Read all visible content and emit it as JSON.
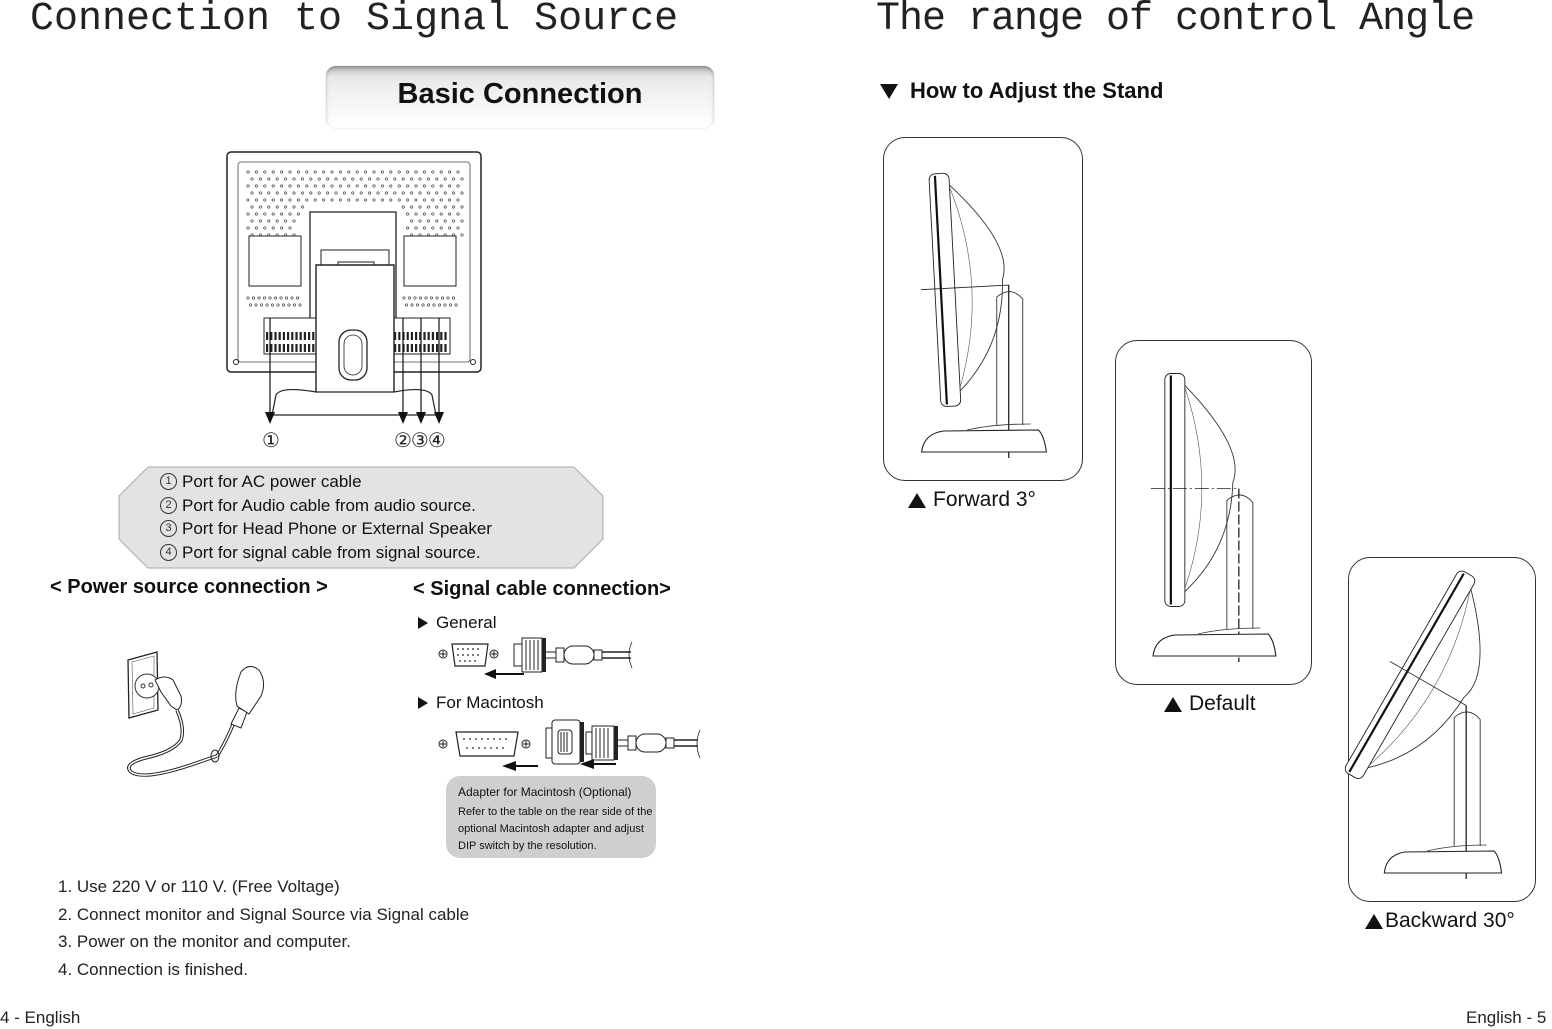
{
  "left_page": {
    "title": "Connection to Signal Source",
    "basic_connection_label": "Basic Connection",
    "port_callouts": [
      "①",
      "②③④"
    ],
    "port_legend": [
      {
        "num": "1",
        "text": "Port for AC power cable"
      },
      {
        "num": "2",
        "text": "Port for Audio cable  from audio source."
      },
      {
        "num": "3",
        "text": "Port for Head Phone or External Speaker"
      },
      {
        "num": "4",
        "text": "Port for signal cable from signal source."
      }
    ],
    "power_heading": "< Power source connection >",
    "signal_heading": "< Signal cable connection>",
    "signal_options": [
      {
        "label": "General",
        "icon": "triangle-right-icon"
      },
      {
        "label": "For Macintosh",
        "icon": "triangle-right-icon"
      }
    ],
    "adapter_note": {
      "title": "Adapter for Macintosh (Optional)",
      "body": "Refer to the table on the rear side of the optional Macintosh adapter and adjust DIP switch by the resolution."
    },
    "steps": [
      "1. Use 220 V or 110 V. (Free Voltage)",
      "2. Connect monitor and Signal Source via Signal cable",
      "3. Power on the monitor and computer.",
      "4. Connection is finished."
    ],
    "footer": "4 - English"
  },
  "right_page": {
    "title": "The range of control  Angle",
    "subheading": "How to Adjust the Stand",
    "positions": [
      {
        "label": "Forward 3°",
        "tilt_degrees": -3
      },
      {
        "label": "Default",
        "tilt_degrees": 0
      },
      {
        "label": "Backward  30°",
        "tilt_degrees": 30
      }
    ],
    "footer": "English - 5"
  }
}
